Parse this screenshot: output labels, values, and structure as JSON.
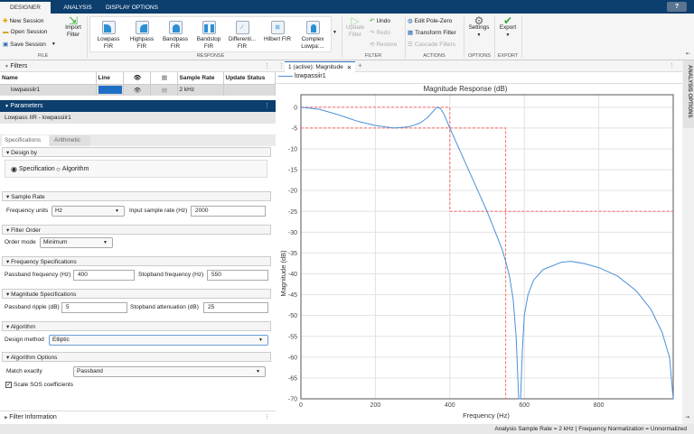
{
  "tabs": [
    {
      "label": "DESIGNER",
      "active": true
    },
    {
      "label": "ANALYSIS"
    },
    {
      "label": "DISPLAY OPTIONS"
    }
  ],
  "help_label": "?",
  "toolstrip": {
    "file": {
      "label": "FILE",
      "new": "New Session",
      "open": "Open Session",
      "save": "Save Session",
      "import_1": "Import",
      "import_2": "Filter"
    },
    "response": {
      "label": "RESPONSE",
      "items": [
        [
          "Lowpass",
          "FIR"
        ],
        [
          "Highpass",
          "FIR"
        ],
        [
          "Bandpass",
          "FIR"
        ],
        [
          "Bandstop",
          "FIR"
        ],
        [
          "Differenti...",
          "FIR"
        ],
        [
          "Hilbert FIR",
          ""
        ],
        [
          "Complex",
          "Lowpa:..."
        ]
      ]
    },
    "filter": {
      "label": "FILTER",
      "update_1": "Update",
      "update_2": "Filter",
      "undo": "Undo",
      "redo": "Redo",
      "restore": "Restore"
    },
    "actions": {
      "label": "ACTIONS",
      "edit": "Edit Pole-Zero",
      "transform": "Transform Filter",
      "cascade": "Cascade Filters"
    },
    "options": {
      "label": "OPTIONS",
      "settings": "Settings"
    },
    "export": {
      "label": "EXPORT",
      "export": "Export"
    }
  },
  "filters": {
    "title": "Filters",
    "columns": [
      "Name",
      "Line",
      "",
      "",
      "Sample Rate",
      "Update Status"
    ],
    "rows": [
      {
        "name": "lowpassiir1",
        "line_color": "#1f6fc5",
        "sample_rate": "2 kHz",
        "status": ""
      }
    ]
  },
  "parameters": {
    "title": "Parameters",
    "subtitle": "Lowpass IIR - lowpassiir1",
    "tabs": [
      "Specifications",
      "Arithmetic"
    ],
    "design_by": {
      "title": "Design by",
      "options": [
        "Specification",
        "Algorithm"
      ],
      "selected": "Specification"
    },
    "sample_rate": {
      "title": "Sample Rate",
      "units_label": "Frequency units",
      "units": "Hz",
      "rate_label": "Input sample rate (Hz)",
      "rate": "2000"
    },
    "filter_order": {
      "title": "Filter Order",
      "mode_label": "Order mode",
      "mode": "Minimum"
    },
    "freq_specs": {
      "title": "Frequency Specifications",
      "pass_label": "Passband frequency (Hz)",
      "pass": "400",
      "stop_label": "Stopband frequency (Hz)",
      "stop": "550"
    },
    "mag_specs": {
      "title": "Magnitude Specifications",
      "ripple_label": "Passband ripple (dB)",
      "ripple": "5",
      "atten_label": "Stopband attenuation (dB)",
      "atten": "25"
    },
    "algorithm": {
      "title": "Algorithm",
      "method_label": "Design method",
      "method": "Elliptic"
    },
    "algorithm_options": {
      "title": "Algorithm Options",
      "match_label": "Match exactly",
      "match": "Passband",
      "scale_label": "Scale SOS coefficients",
      "scale_checked": true
    }
  },
  "filter_information": {
    "title": "Filter Information"
  },
  "plot_tab": {
    "label": "1 (active): Magnitude",
    "add": "+"
  },
  "analysis_options_label": "ANALYSIS OPTIONS",
  "status": "Analysis Sample Rate = 2 kHz | Frequency Normalization = Unnormalized",
  "chart_data": {
    "type": "line",
    "title": "Magnitude Response (dB)",
    "xlabel": "Frequency (Hz)",
    "ylabel": "Magnitude (dB)",
    "xlim": [
      0,
      1000
    ],
    "ylim": [
      -70,
      3
    ],
    "grid": true,
    "xticks": [
      0,
      200,
      400,
      600,
      800
    ],
    "yticks": [
      0,
      -5,
      -10,
      -15,
      -20,
      -25,
      -30,
      -35,
      -40,
      -45,
      -50,
      -55,
      -60,
      -65,
      -70
    ],
    "legend": "top-left",
    "series": [
      {
        "name": "lowpassiir1",
        "color": "#4a90d9",
        "x": [
          0,
          50,
          100,
          150,
          200,
          250,
          290,
          320,
          340,
          355,
          365,
          375,
          385,
          400,
          420,
          450,
          480,
          500,
          520,
          540,
          550,
          560,
          570,
          578,
          585,
          590,
          595,
          600,
          610,
          625,
          650,
          700,
          725,
          760,
          800,
          850,
          900,
          940,
          970,
          990,
          1000
        ],
        "y": [
          0,
          -0.5,
          -1.8,
          -3.3,
          -4.4,
          -5,
          -4.7,
          -3.8,
          -2.5,
          -1,
          0,
          -0.3,
          -1.8,
          -5,
          -9,
          -15,
          -21,
          -25,
          -29.5,
          -34,
          -37,
          -40.5,
          -46,
          -55,
          -70,
          -70,
          -58,
          -50,
          -45,
          -41.5,
          -39,
          -37.2,
          -37,
          -37.5,
          -38.5,
          -40.5,
          -44,
          -48.5,
          -54,
          -60,
          -70
        ]
      },
      {
        "name": "mask",
        "color": "#ff6666",
        "segments": [
          [
            [
              0,
              0
            ],
            [
              400,
              0
            ],
            [
              400,
              -25
            ],
            [
              1000,
              -25
            ]
          ],
          [
            [
              0,
              -5
            ],
            [
              550,
              -5
            ],
            [
              550,
              -70
            ]
          ]
        ]
      }
    ]
  }
}
